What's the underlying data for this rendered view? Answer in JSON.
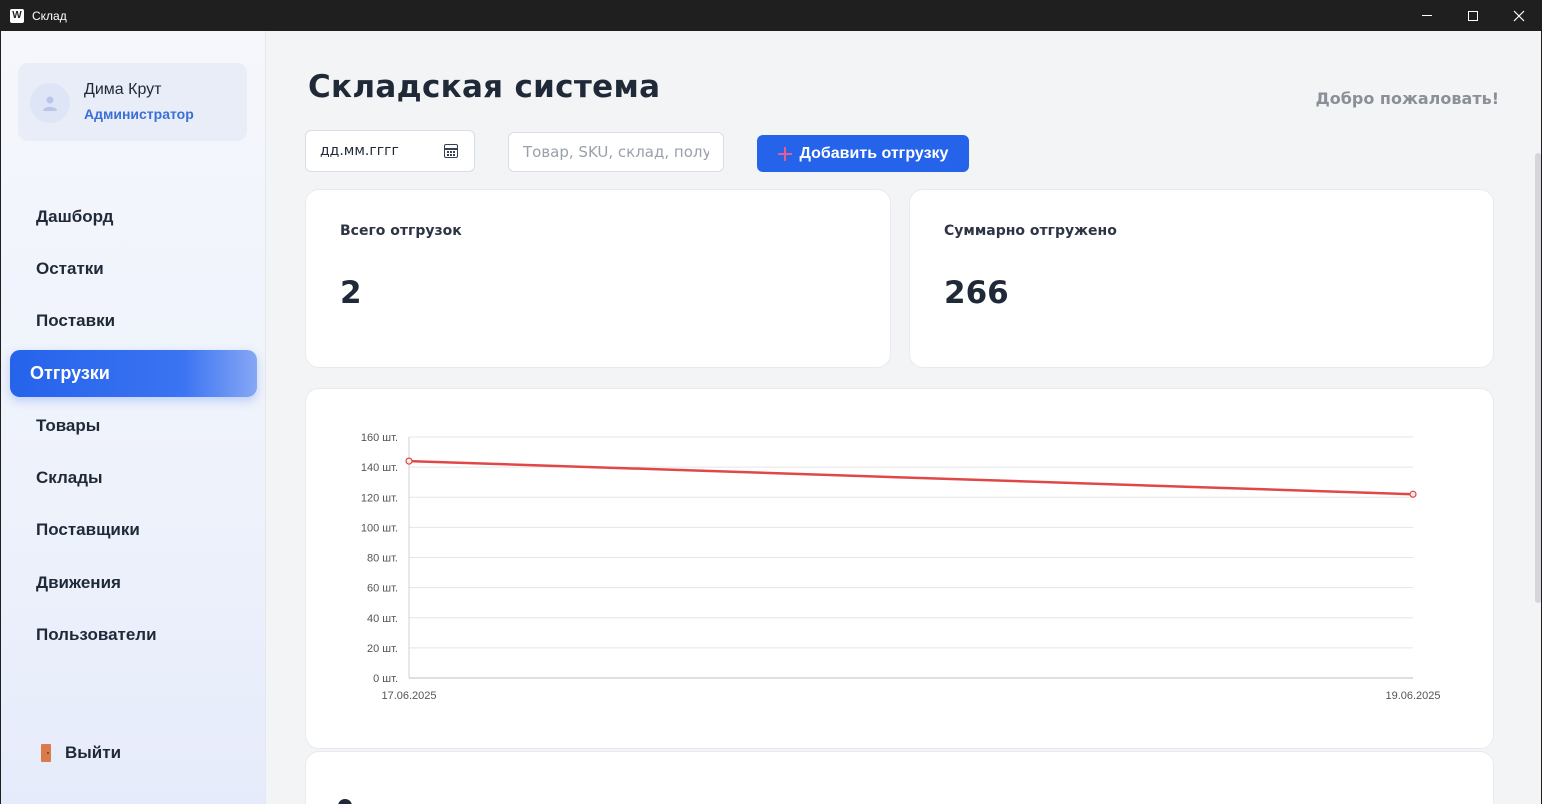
{
  "window": {
    "title": "Склад",
    "app_icon": "W",
    "icons": [
      "minimize-icon",
      "maximize-icon",
      "close-icon"
    ]
  },
  "sidebar": {
    "user": {
      "name": "Дима Крут",
      "role": "Администратор",
      "icon": "user-icon"
    },
    "items": [
      {
        "label": "Дашборд",
        "active": false
      },
      {
        "label": "Остатки",
        "active": false
      },
      {
        "label": "Поставки",
        "active": false
      },
      {
        "label": "Отгрузки",
        "active": true
      },
      {
        "label": "Товары",
        "active": false
      },
      {
        "label": "Склады",
        "active": false
      },
      {
        "label": "Поставщики",
        "active": false
      },
      {
        "label": "Движения",
        "active": false
      },
      {
        "label": "Пользователи",
        "active": false
      }
    ],
    "logout_label": "Выйти",
    "logout_icon": "door-icon"
  },
  "header": {
    "title": "Складская система",
    "welcome": "Добро пожаловать!"
  },
  "filters": {
    "date_placeholder": "дд.мм.гггг",
    "search_placeholder": "Товар, SKU, склад, получ",
    "add_button_label": "Добавить отгрузку"
  },
  "stats": {
    "total_label": "Всего отгрузок",
    "total_value": "2",
    "sum_label": "Суммарно отгружено",
    "sum_value": "266"
  },
  "colors": {
    "accent": "#2563eb",
    "series": "#e04848",
    "plus": "#e35d8d"
  },
  "chart_data": {
    "type": "line",
    "x": [
      "17.06.2025",
      "19.06.2025"
    ],
    "series": [
      {
        "values": [
          144,
          122
        ],
        "color": "#e04848"
      }
    ],
    "yticks": [
      "0 шт.",
      "20 шт.",
      "40 шт.",
      "60 шт.",
      "80 шт.",
      "100 шт.",
      "120 шт.",
      "140 шт.",
      "160 шт."
    ],
    "ylim": [
      0,
      160
    ],
    "grid": true,
    "title": "",
    "xlabel": "",
    "ylabel": ""
  }
}
